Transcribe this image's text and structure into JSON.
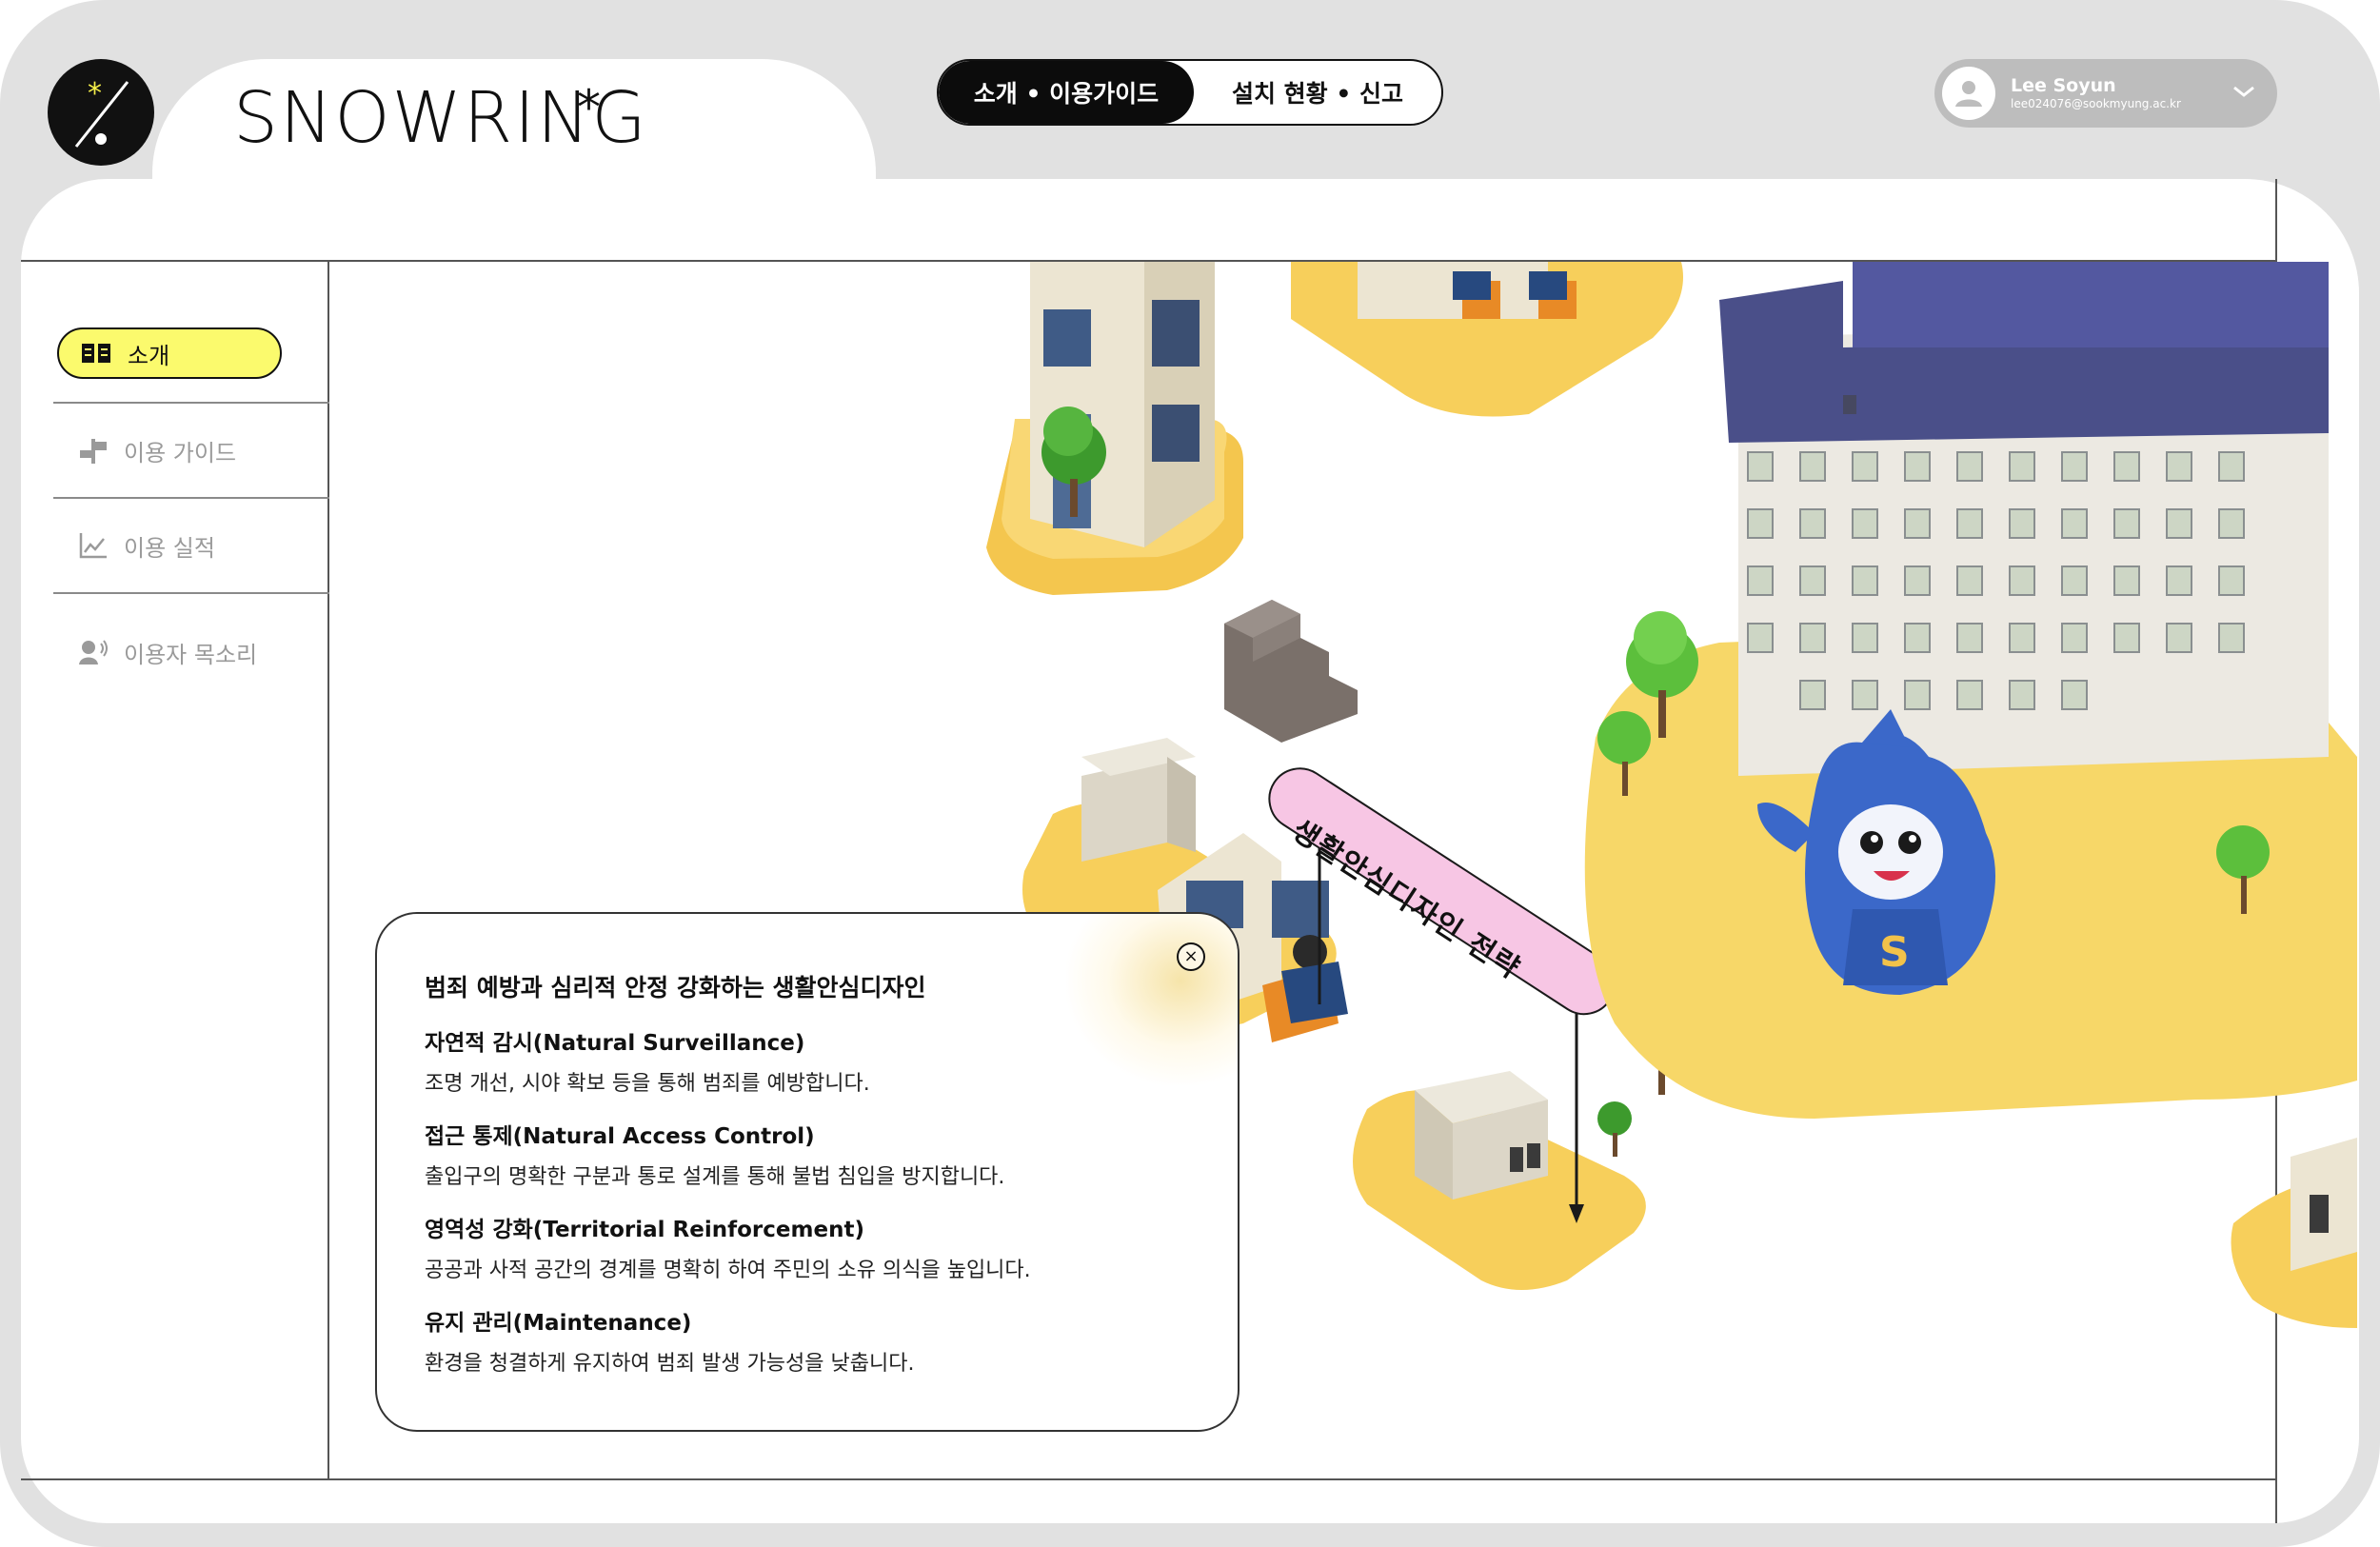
{
  "brand": {
    "name": "SNOWRING",
    "star": "*"
  },
  "colors": {
    "accent_yellow": "#fbfa6d",
    "frame_gray": "#e1e1e1",
    "tab_active": "#0c0c0c",
    "sign_pink": "#f7c6e4"
  },
  "nav_tabs": [
    {
      "label": "소개 • 이용가이드",
      "active": true
    },
    {
      "label": "설치 현황 • 신고",
      "active": false
    }
  ],
  "user": {
    "name": "Lee Soyun",
    "email": "lee024076@sookmyung.ac.kr",
    "icon": "chevron-down-icon"
  },
  "sidebar": {
    "items": [
      {
        "label": "소개",
        "icon": "book-icon",
        "active": true
      },
      {
        "label": "이용 가이드",
        "icon": "signpost-icon",
        "active": false
      },
      {
        "label": "이용 실적",
        "icon": "line-chart-icon",
        "active": false
      },
      {
        "label": "이용자 목소리",
        "icon": "user-voice-icon",
        "active": false
      }
    ]
  },
  "illustration": {
    "sign_label": "생활안심디자인 전략"
  },
  "card": {
    "title": "범죄 예방과 심리적 안정 강화하는 생활안심디자인",
    "items": [
      {
        "title": "자연적 감시(Natural Surveillance)",
        "desc": "조명 개선, 시야 확보 등을 통해 범죄를 예방합니다."
      },
      {
        "title": "접근 통제(Natural Access Control)",
        "desc": "출입구의 명확한 구분과 통로 설계를 통해 불법 침입을 방지합니다."
      },
      {
        "title": "영역성 강화(Territorial Reinforcement)",
        "desc": "공공과 사적 공간의 경계를 명확히 하여 주민의 소유 의식을 높입니다."
      },
      {
        "title": "유지 관리(Maintenance)",
        "desc": "환경을 청결하게 유지하여 범죄 발생 가능성을 낮춥니다."
      }
    ],
    "close_icon": "close-icon"
  }
}
